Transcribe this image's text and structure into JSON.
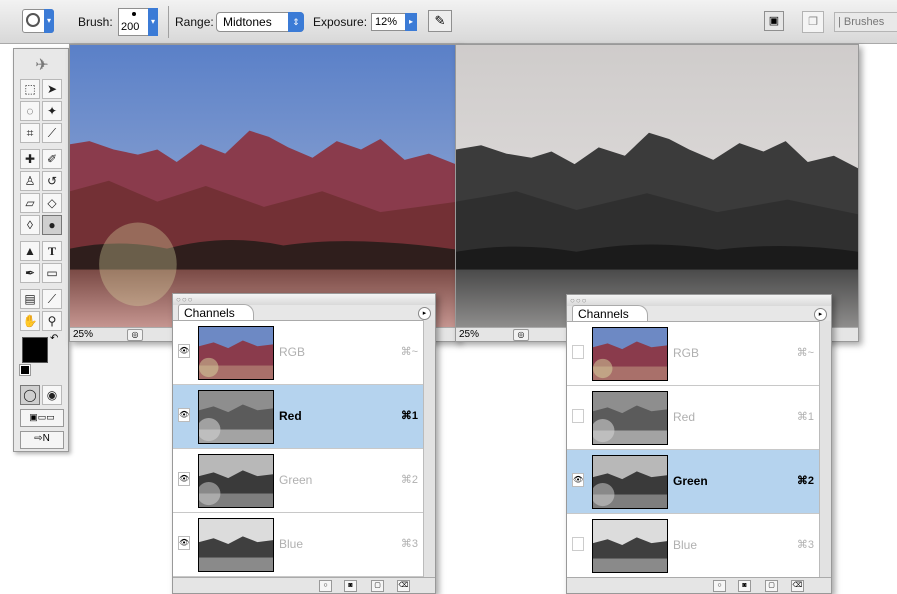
{
  "options_bar": {
    "brush_label": "Brush:",
    "brush_size": "200",
    "range_label": "Range:",
    "range_value": "Midtones",
    "exposure_label": "Exposure:",
    "exposure_value": "12%",
    "brushes_tab": "| Brushes"
  },
  "toolbox": {
    "tools": [
      "marquee-tool",
      "move-tool",
      "lasso-tool",
      "magic-wand-tool",
      "crop-tool",
      "slice-tool",
      "healing-brush-tool",
      "brush-tool",
      "clone-stamp-tool",
      "history-brush-tool",
      "eraser-tool",
      "paint-bucket-tool",
      "blur-tool",
      "dodge-tool",
      "path-selection-tool",
      "type-tool",
      "pen-tool",
      "shape-tool",
      "notes-tool",
      "eyedropper-tool",
      "hand-tool",
      "zoom-tool"
    ],
    "type_glyph": "T"
  },
  "windows": {
    "left": {
      "zoom": "25%"
    },
    "right": {
      "zoom": "25%"
    }
  },
  "palettes": {
    "left": {
      "title": "Channels",
      "channels": [
        {
          "name": "RGB",
          "shortcut": "⌘~",
          "visible": true,
          "selected": false
        },
        {
          "name": "Red",
          "shortcut": "⌘1",
          "visible": true,
          "selected": true
        },
        {
          "name": "Green",
          "shortcut": "⌘2",
          "visible": true,
          "selected": false
        },
        {
          "name": "Blue",
          "shortcut": "⌘3",
          "visible": true,
          "selected": false
        }
      ]
    },
    "right": {
      "title": "Channels",
      "channels": [
        {
          "name": "RGB",
          "shortcut": "⌘~",
          "visible": false,
          "selected": false
        },
        {
          "name": "Red",
          "shortcut": "⌘1",
          "visible": false,
          "selected": false
        },
        {
          "name": "Green",
          "shortcut": "⌘2",
          "visible": true,
          "selected": true
        },
        {
          "name": "Blue",
          "shortcut": "⌘3",
          "visible": false,
          "selected": false
        }
      ]
    }
  },
  "colors": {
    "accent": "#3b7bd6",
    "selection": "#b5d3ee"
  }
}
